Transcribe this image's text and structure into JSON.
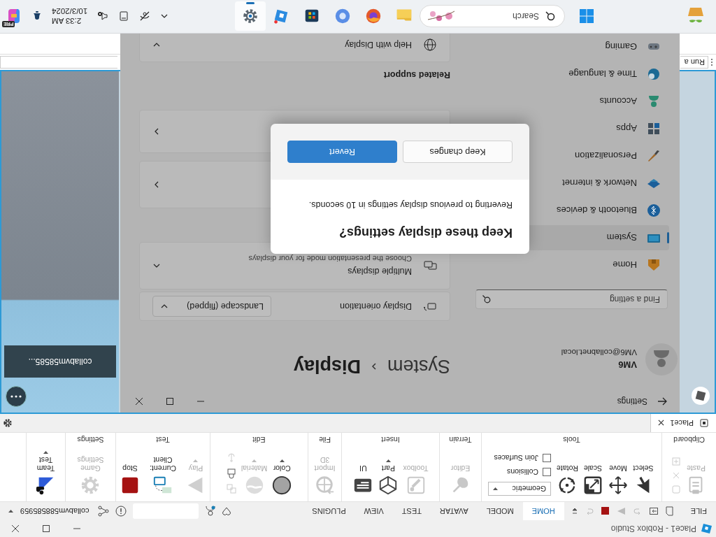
{
  "studio_window": {
    "title": "Place1 - Roblox Studio"
  },
  "menu_tabs": [
    {
      "label": "FILE",
      "selected": false
    },
    {
      "label": "HOME",
      "selected": true
    },
    {
      "label": "MODEL",
      "selected": false
    },
    {
      "label": "AVATAR",
      "selected": false
    },
    {
      "label": "TEST",
      "selected": false
    },
    {
      "label": "VIEW",
      "selected": false
    },
    {
      "label": "PLUGINS",
      "selected": false
    }
  ],
  "account": {
    "name": "collabvm588585959"
  },
  "ribbon": {
    "groups": [
      {
        "label": "Clipboard",
        "tools": [
          {
            "label": "Paste",
            "disabled": true,
            "menu": false
          }
        ]
      },
      {
        "label": "Tools",
        "tools": [
          {
            "label": "Select",
            "disabled": false,
            "menu": false
          },
          {
            "label": "Move",
            "disabled": false,
            "menu": false
          },
          {
            "label": "Scale",
            "disabled": false,
            "menu": false
          },
          {
            "label": "Rotate",
            "disabled": false,
            "menu": false
          }
        ],
        "dropdown": {
          "value": "Geometric"
        },
        "options": [
          {
            "label": "Collisions",
            "checked": false
          },
          {
            "label": "Join Surfaces",
            "checked": false
          }
        ]
      },
      {
        "label": "Terrain",
        "tools": [
          {
            "label": "Editor",
            "disabled": true,
            "menu": false
          }
        ]
      },
      {
        "label": "Insert",
        "tools": [
          {
            "label": "Toolbox",
            "disabled": true,
            "menu": false
          },
          {
            "label": "Part",
            "disabled": false,
            "menu": true
          },
          {
            "label": "UI",
            "disabled": false,
            "menu": false
          }
        ]
      },
      {
        "label": "File",
        "tools": [
          {
            "label": "Import 3D",
            "disabled": true,
            "menu": false
          }
        ]
      },
      {
        "label": "Edit",
        "tools": [
          {
            "label": "Color",
            "disabled": false,
            "menu": true
          },
          {
            "label": "Material",
            "disabled": true,
            "menu": true
          }
        ]
      },
      {
        "label": "Test",
        "tools": [
          {
            "label": "Play",
            "disabled": true,
            "menu": true
          },
          {
            "label": "Current: Client",
            "disabled": false,
            "menu": false
          },
          {
            "label": "Stop",
            "disabled": false,
            "menu": false
          }
        ]
      },
      {
        "label": "Settings",
        "tools": [
          {
            "label": "Game Settings",
            "disabled": true,
            "menu": false
          }
        ]
      },
      {
        "tools": [
          {
            "label": "Team Test",
            "disabled": false,
            "menu": true
          }
        ]
      }
    ]
  },
  "document_tabs": [
    {
      "label": "Place1",
      "selected": true
    }
  ],
  "viewport": {
    "label": "collabvm58585..."
  },
  "command_bar": {
    "placeholder": "Run a"
  },
  "settings": {
    "title": "Settings",
    "user": {
      "name": "VM6",
      "email": "VM6@collabnet.local"
    },
    "breadcrumb": {
      "parent": "System",
      "current": "Display"
    },
    "search": {
      "placeholder": "Find a setting"
    },
    "nav": [
      {
        "label": "Home",
        "selected": false
      },
      {
        "label": "System",
        "selected": true
      },
      {
        "label": "Bluetooth & devices",
        "selected": false
      },
      {
        "label": "Network & internet",
        "selected": false
      },
      {
        "label": "Personalization",
        "selected": false
      },
      {
        "label": "Apps",
        "selected": false
      },
      {
        "label": "Accounts",
        "selected": false
      },
      {
        "label": "Time & language",
        "selected": false
      },
      {
        "label": "Gaming",
        "selected": false
      }
    ],
    "cards": [
      {
        "kind": "dropdown",
        "title": "Display orientation",
        "value": "Landscape (flipped)"
      },
      {
        "kind": "expander",
        "title": "Multiple displays",
        "subtitle": "Choose the presentation mode for your displays"
      },
      {
        "kind": "link"
      },
      {
        "kind": "link"
      }
    ],
    "related": {
      "heading": "Related support",
      "items": [
        {
          "title": "Help with Display"
        }
      ]
    }
  },
  "dialog": {
    "title": "Keep these display settings?",
    "message": "Reverting to previous display settings in 10 seconds.",
    "buttons": [
      {
        "label": "Keep changes",
        "primary": false
      },
      {
        "label": "Revert",
        "primary": true
      }
    ]
  },
  "taskbar": {
    "search_placeholder": "Search",
    "apps": [
      {
        "selected": false
      },
      {
        "selected": false
      },
      {
        "selected": false
      },
      {
        "selected": false
      },
      {
        "selected": false
      },
      {
        "selected": true
      }
    ],
    "clock": {
      "time": "2:33 AM",
      "date": "10/3/2024"
    },
    "copilot_badge": "PRE"
  }
}
